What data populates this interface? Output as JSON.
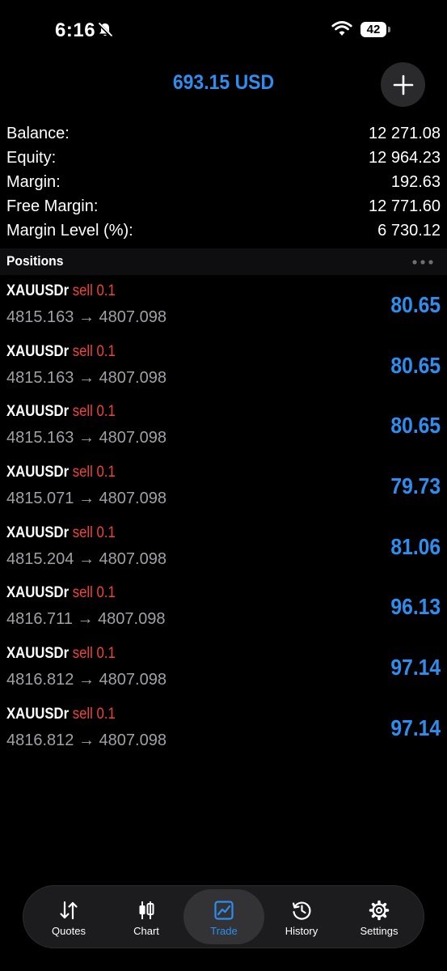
{
  "status_bar": {
    "time": "6:16",
    "battery": "42"
  },
  "header": {
    "title": "693.15 USD"
  },
  "summary": [
    {
      "label": "Balance:",
      "value": "12 271.08"
    },
    {
      "label": "Equity:",
      "value": "12 964.23"
    },
    {
      "label": "Margin:",
      "value": "192.63"
    },
    {
      "label": "Free Margin:",
      "value": "12 771.60"
    },
    {
      "label": "Margin Level (%):",
      "value": "6 730.12"
    }
  ],
  "positions": {
    "title": "Positions",
    "items": [
      {
        "symbol": "XAUUSDr",
        "side": "sell",
        "lot": "0.1",
        "open": "4815.163",
        "arrow": "→",
        "current": "4807.098",
        "profit": "80.65"
      },
      {
        "symbol": "XAUUSDr",
        "side": "sell",
        "lot": "0.1",
        "open": "4815.163",
        "arrow": "→",
        "current": "4807.098",
        "profit": "80.65"
      },
      {
        "symbol": "XAUUSDr",
        "side": "sell",
        "lot": "0.1",
        "open": "4815.163",
        "arrow": "→",
        "current": "4807.098",
        "profit": "80.65"
      },
      {
        "symbol": "XAUUSDr",
        "side": "sell",
        "lot": "0.1",
        "open": "4815.071",
        "arrow": "→",
        "current": "4807.098",
        "profit": "79.73"
      },
      {
        "symbol": "XAUUSDr",
        "side": "sell",
        "lot": "0.1",
        "open": "4815.204",
        "arrow": "→",
        "current": "4807.098",
        "profit": "81.06"
      },
      {
        "symbol": "XAUUSDr",
        "side": "sell",
        "lot": "0.1",
        "open": "4816.711",
        "arrow": "→",
        "current": "4807.098",
        "profit": "96.13"
      },
      {
        "symbol": "XAUUSDr",
        "side": "sell",
        "lot": "0.1",
        "open": "4816.812",
        "arrow": "→",
        "current": "4807.098",
        "profit": "97.14"
      },
      {
        "symbol": "XAUUSDr",
        "side": "sell",
        "lot": "0.1",
        "open": "4816.812",
        "arrow": "→",
        "current": "4807.098",
        "profit": "97.14"
      }
    ]
  },
  "tabs": [
    {
      "label": "Quotes",
      "icon": "quotes-arrows-icon",
      "active": false
    },
    {
      "label": "Chart",
      "icon": "candlestick-icon",
      "active": false
    },
    {
      "label": "Trade",
      "icon": "trade-chart-icon",
      "active": true
    },
    {
      "label": "History",
      "icon": "history-clock-icon",
      "active": false
    },
    {
      "label": "Settings",
      "icon": "gear-icon",
      "active": false
    }
  ],
  "colors": {
    "accent": "#2e8ef0",
    "sell": "#f0443a",
    "background": "#000000"
  }
}
